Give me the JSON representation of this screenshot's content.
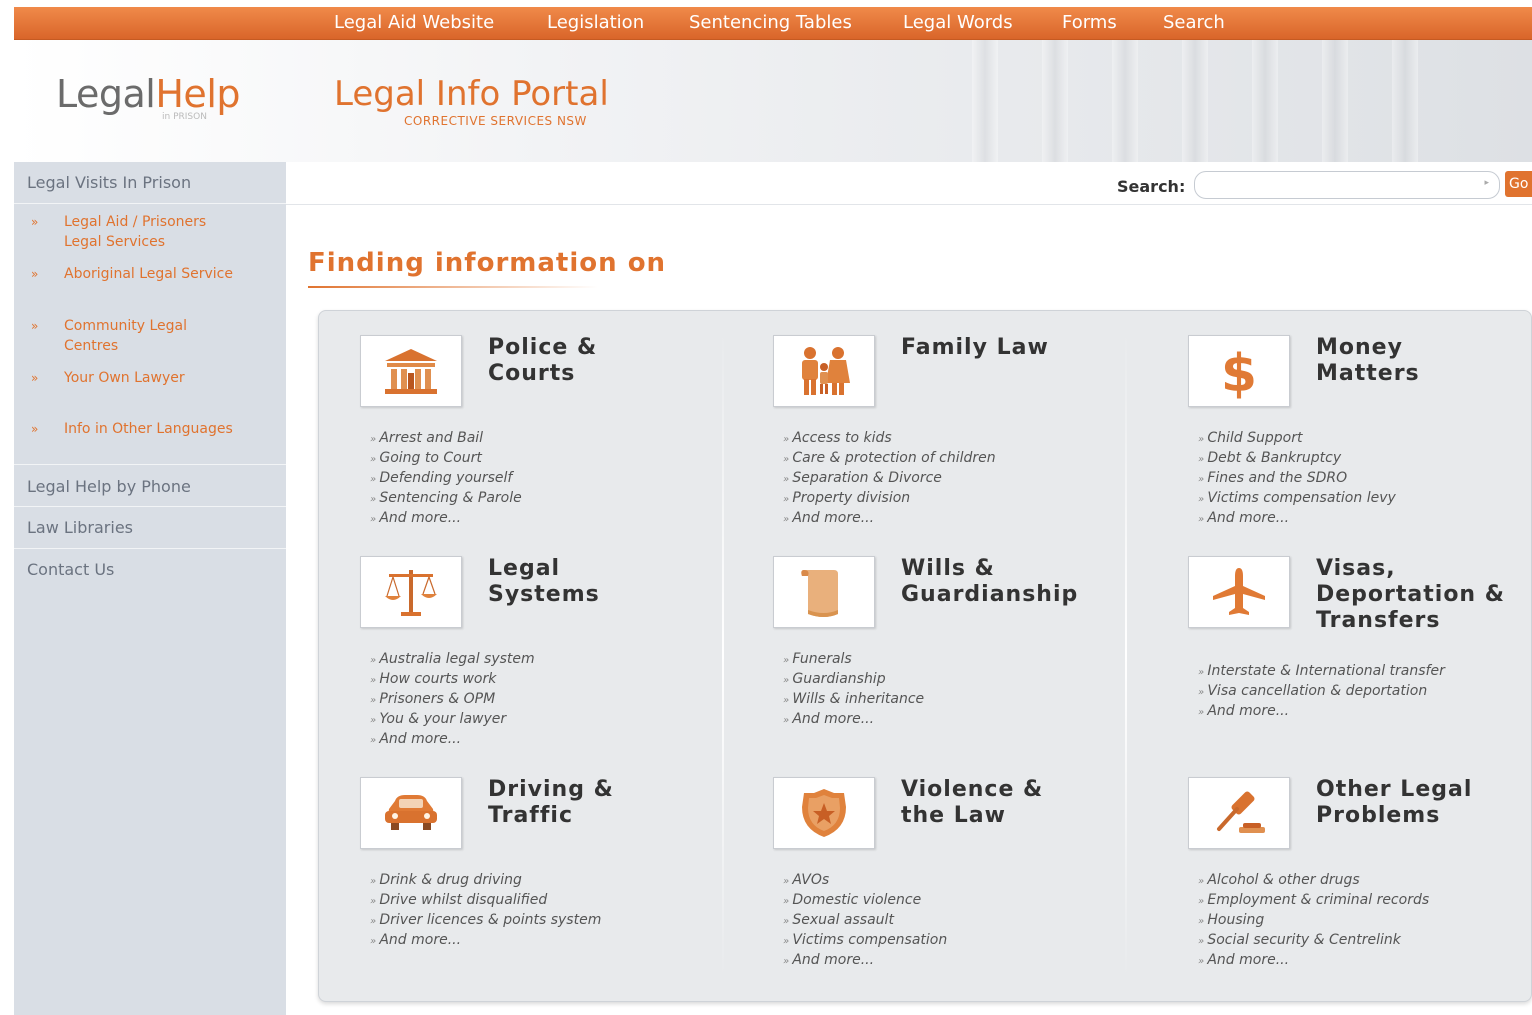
{
  "nav": {
    "items": [
      "Legal Aid Website",
      "Legislation",
      "Sentencing Tables",
      "Legal Words",
      "Forms",
      "Search"
    ]
  },
  "header": {
    "logo_grey": "Legal",
    "logo_orange": "Help",
    "logo_sub": "in PRISON",
    "portal_title": "Legal Info Portal",
    "portal_subtitle": "CORRECTIVE SERVICES NSW"
  },
  "sidebar": {
    "visits": "Legal Visits In Prison",
    "sub_items": [
      "Legal Aid / Prisoners Legal Services",
      "Aboriginal Legal Service",
      "Community Legal Centres",
      "Your Own Lawyer",
      "Info in Other Languages"
    ],
    "phone": "Legal Help by Phone",
    "libraries": "Law Libraries",
    "contact": "Contact Us",
    "arrow": "»"
  },
  "search": {
    "label": "Search:",
    "value": "",
    "go": "Go"
  },
  "page_title": "Finding information on",
  "categories": [
    {
      "title": "Police & Courts",
      "icon": "courthouse-icon",
      "links": [
        "Arrest and Bail",
        "Going to Court",
        "Defending yourself",
        "Sentencing & Parole",
        "And more..."
      ]
    },
    {
      "title": "Family Law",
      "icon": "family-icon",
      "links": [
        "Access to kids",
        "Care & protection of children",
        "Separation & Divorce",
        "Property division",
        "And more..."
      ]
    },
    {
      "title": "Money Matters",
      "icon": "dollar-icon",
      "links": [
        "Child Support",
        "Debt & Bankruptcy",
        "Fines and the SDRO",
        "Victims compensation levy",
        "And more..."
      ]
    },
    {
      "title": "Legal Systems",
      "icon": "scales-icon",
      "links": [
        "Australia legal system",
        "How courts work",
        "Prisoners & OPM",
        "You & your lawyer",
        "And more..."
      ]
    },
    {
      "title": "Wills & Guardianship",
      "icon": "scroll-icon",
      "links": [
        "Funerals",
        "Guardianship",
        "Wills & inheritance",
        "And more..."
      ]
    },
    {
      "title": "Visas, Deportation & Transfers",
      "icon": "airplane-icon",
      "links": [
        "Interstate & International transfer",
        "Visa cancellation & deportation",
        "And more..."
      ]
    },
    {
      "title": "Driving & Traffic",
      "icon": "car-icon",
      "links": [
        "Drink & drug driving",
        "Drive whilst disqualified",
        "Driver licences & points system",
        "And more..."
      ]
    },
    {
      "title": "Violence & the Law",
      "icon": "police-badge-icon",
      "links": [
        "AVOs",
        "Domestic violence",
        "Sexual assault",
        "Victims compensation",
        "And more..."
      ]
    },
    {
      "title": "Other Legal Problems",
      "icon": "gavel-icon",
      "links": [
        "Alcohol & other drugs",
        "Employment & criminal records",
        "Housing",
        "Social security & Centrelink",
        "And more..."
      ]
    }
  ],
  "colors": {
    "accent": "#e0732f",
    "sidebar_bg": "#d9dee5",
    "panel_bg": "#e8eaec"
  }
}
